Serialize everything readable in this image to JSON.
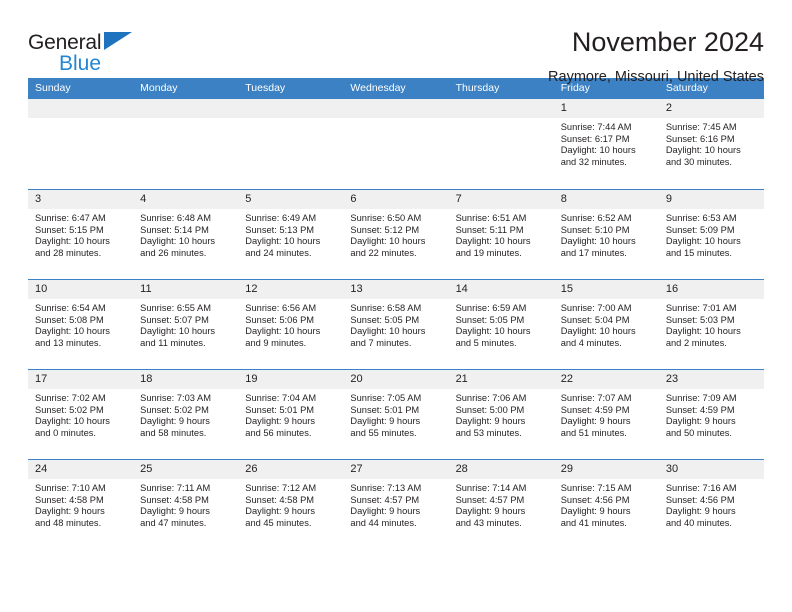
{
  "brand": {
    "name_part1": "General",
    "name_part2": "Blue",
    "triangle_color": "#1f72bd",
    "blue_text_color": "#2386d4"
  },
  "header": {
    "title": "November 2024",
    "subtitle": "Raymore, Missouri, United States"
  },
  "theme": {
    "header_row_bg": "#3b81c4",
    "day_number_bg": "#f0f0f0",
    "text_color": "#231f20"
  },
  "weekdays": [
    "Sunday",
    "Monday",
    "Tuesday",
    "Wednesday",
    "Thursday",
    "Friday",
    "Saturday"
  ],
  "labels": {
    "sunrise": "Sunrise:",
    "sunset": "Sunset:",
    "daylight": "Daylight:"
  },
  "weeks": [
    [
      {
        "day": "",
        "empty": true
      },
      {
        "day": "",
        "empty": true
      },
      {
        "day": "",
        "empty": true
      },
      {
        "day": "",
        "empty": true
      },
      {
        "day": "",
        "empty": true
      },
      {
        "day": "1",
        "sunrise": "Sunrise: 7:44 AM",
        "sunset": "Sunset: 6:17 PM",
        "daylight1": "Daylight: 10 hours",
        "daylight2": "and 32 minutes."
      },
      {
        "day": "2",
        "sunrise": "Sunrise: 7:45 AM",
        "sunset": "Sunset: 6:16 PM",
        "daylight1": "Daylight: 10 hours",
        "daylight2": "and 30 minutes."
      }
    ],
    [
      {
        "day": "3",
        "sunrise": "Sunrise: 6:47 AM",
        "sunset": "Sunset: 5:15 PM",
        "daylight1": "Daylight: 10 hours",
        "daylight2": "and 28 minutes."
      },
      {
        "day": "4",
        "sunrise": "Sunrise: 6:48 AM",
        "sunset": "Sunset: 5:14 PM",
        "daylight1": "Daylight: 10 hours",
        "daylight2": "and 26 minutes."
      },
      {
        "day": "5",
        "sunrise": "Sunrise: 6:49 AM",
        "sunset": "Sunset: 5:13 PM",
        "daylight1": "Daylight: 10 hours",
        "daylight2": "and 24 minutes."
      },
      {
        "day": "6",
        "sunrise": "Sunrise: 6:50 AM",
        "sunset": "Sunset: 5:12 PM",
        "daylight1": "Daylight: 10 hours",
        "daylight2": "and 22 minutes."
      },
      {
        "day": "7",
        "sunrise": "Sunrise: 6:51 AM",
        "sunset": "Sunset: 5:11 PM",
        "daylight1": "Daylight: 10 hours",
        "daylight2": "and 19 minutes."
      },
      {
        "day": "8",
        "sunrise": "Sunrise: 6:52 AM",
        "sunset": "Sunset: 5:10 PM",
        "daylight1": "Daylight: 10 hours",
        "daylight2": "and 17 minutes."
      },
      {
        "day": "9",
        "sunrise": "Sunrise: 6:53 AM",
        "sunset": "Sunset: 5:09 PM",
        "daylight1": "Daylight: 10 hours",
        "daylight2": "and 15 minutes."
      }
    ],
    [
      {
        "day": "10",
        "sunrise": "Sunrise: 6:54 AM",
        "sunset": "Sunset: 5:08 PM",
        "daylight1": "Daylight: 10 hours",
        "daylight2": "and 13 minutes."
      },
      {
        "day": "11",
        "sunrise": "Sunrise: 6:55 AM",
        "sunset": "Sunset: 5:07 PM",
        "daylight1": "Daylight: 10 hours",
        "daylight2": "and 11 minutes."
      },
      {
        "day": "12",
        "sunrise": "Sunrise: 6:56 AM",
        "sunset": "Sunset: 5:06 PM",
        "daylight1": "Daylight: 10 hours",
        "daylight2": "and 9 minutes."
      },
      {
        "day": "13",
        "sunrise": "Sunrise: 6:58 AM",
        "sunset": "Sunset: 5:05 PM",
        "daylight1": "Daylight: 10 hours",
        "daylight2": "and 7 minutes."
      },
      {
        "day": "14",
        "sunrise": "Sunrise: 6:59 AM",
        "sunset": "Sunset: 5:05 PM",
        "daylight1": "Daylight: 10 hours",
        "daylight2": "and 5 minutes."
      },
      {
        "day": "15",
        "sunrise": "Sunrise: 7:00 AM",
        "sunset": "Sunset: 5:04 PM",
        "daylight1": "Daylight: 10 hours",
        "daylight2": "and 4 minutes."
      },
      {
        "day": "16",
        "sunrise": "Sunrise: 7:01 AM",
        "sunset": "Sunset: 5:03 PM",
        "daylight1": "Daylight: 10 hours",
        "daylight2": "and 2 minutes."
      }
    ],
    [
      {
        "day": "17",
        "sunrise": "Sunrise: 7:02 AM",
        "sunset": "Sunset: 5:02 PM",
        "daylight1": "Daylight: 10 hours",
        "daylight2": "and 0 minutes."
      },
      {
        "day": "18",
        "sunrise": "Sunrise: 7:03 AM",
        "sunset": "Sunset: 5:02 PM",
        "daylight1": "Daylight: 9 hours",
        "daylight2": "and 58 minutes."
      },
      {
        "day": "19",
        "sunrise": "Sunrise: 7:04 AM",
        "sunset": "Sunset: 5:01 PM",
        "daylight1": "Daylight: 9 hours",
        "daylight2": "and 56 minutes."
      },
      {
        "day": "20",
        "sunrise": "Sunrise: 7:05 AM",
        "sunset": "Sunset: 5:01 PM",
        "daylight1": "Daylight: 9 hours",
        "daylight2": "and 55 minutes."
      },
      {
        "day": "21",
        "sunrise": "Sunrise: 7:06 AM",
        "sunset": "Sunset: 5:00 PM",
        "daylight1": "Daylight: 9 hours",
        "daylight2": "and 53 minutes."
      },
      {
        "day": "22",
        "sunrise": "Sunrise: 7:07 AM",
        "sunset": "Sunset: 4:59 PM",
        "daylight1": "Daylight: 9 hours",
        "daylight2": "and 51 minutes."
      },
      {
        "day": "23",
        "sunrise": "Sunrise: 7:09 AM",
        "sunset": "Sunset: 4:59 PM",
        "daylight1": "Daylight: 9 hours",
        "daylight2": "and 50 minutes."
      }
    ],
    [
      {
        "day": "24",
        "sunrise": "Sunrise: 7:10 AM",
        "sunset": "Sunset: 4:58 PM",
        "daylight1": "Daylight: 9 hours",
        "daylight2": "and 48 minutes."
      },
      {
        "day": "25",
        "sunrise": "Sunrise: 7:11 AM",
        "sunset": "Sunset: 4:58 PM",
        "daylight1": "Daylight: 9 hours",
        "daylight2": "and 47 minutes."
      },
      {
        "day": "26",
        "sunrise": "Sunrise: 7:12 AM",
        "sunset": "Sunset: 4:58 PM",
        "daylight1": "Daylight: 9 hours",
        "daylight2": "and 45 minutes."
      },
      {
        "day": "27",
        "sunrise": "Sunrise: 7:13 AM",
        "sunset": "Sunset: 4:57 PM",
        "daylight1": "Daylight: 9 hours",
        "daylight2": "and 44 minutes."
      },
      {
        "day": "28",
        "sunrise": "Sunrise: 7:14 AM",
        "sunset": "Sunset: 4:57 PM",
        "daylight1": "Daylight: 9 hours",
        "daylight2": "and 43 minutes."
      },
      {
        "day": "29",
        "sunrise": "Sunrise: 7:15 AM",
        "sunset": "Sunset: 4:56 PM",
        "daylight1": "Daylight: 9 hours",
        "daylight2": "and 41 minutes."
      },
      {
        "day": "30",
        "sunrise": "Sunrise: 7:16 AM",
        "sunset": "Sunset: 4:56 PM",
        "daylight1": "Daylight: 9 hours",
        "daylight2": "and 40 minutes."
      }
    ]
  ]
}
